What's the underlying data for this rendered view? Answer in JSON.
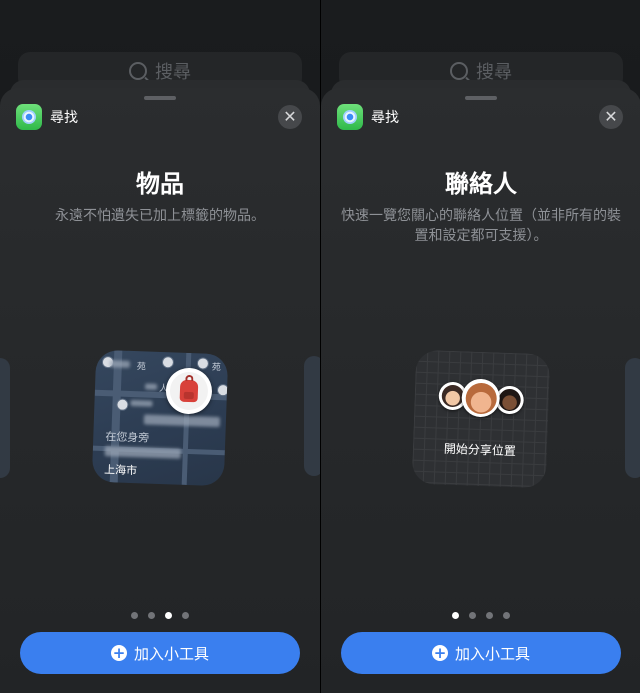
{
  "background": {
    "search_placeholder": "搜尋"
  },
  "screens": [
    {
      "app_name": "尋找",
      "close_label": "✕",
      "title": "物品",
      "subtitle": "永遠不怕遺失已加上標籤的物品。",
      "widget": {
        "status": "在您身旁",
        "city": "上海市",
        "map_labels": [
          "苑",
          "苑",
          "人"
        ]
      },
      "page_dots": {
        "count": 4,
        "active": 3
      },
      "add_button": "加入小工具"
    },
    {
      "app_name": "尋找",
      "close_label": "✕",
      "title": "聯絡人",
      "subtitle": "快速一覽您關心的聯絡人位置（並非所有的裝置和設定都可支援）。",
      "widget": {
        "label": "開始分享位置"
      },
      "page_dots": {
        "count": 4,
        "active": 1
      },
      "add_button": "加入小工具"
    }
  ],
  "colors": {
    "accent": "#3a7fef",
    "sheet": "#2b2d2f",
    "app_icon": "#34c759"
  }
}
